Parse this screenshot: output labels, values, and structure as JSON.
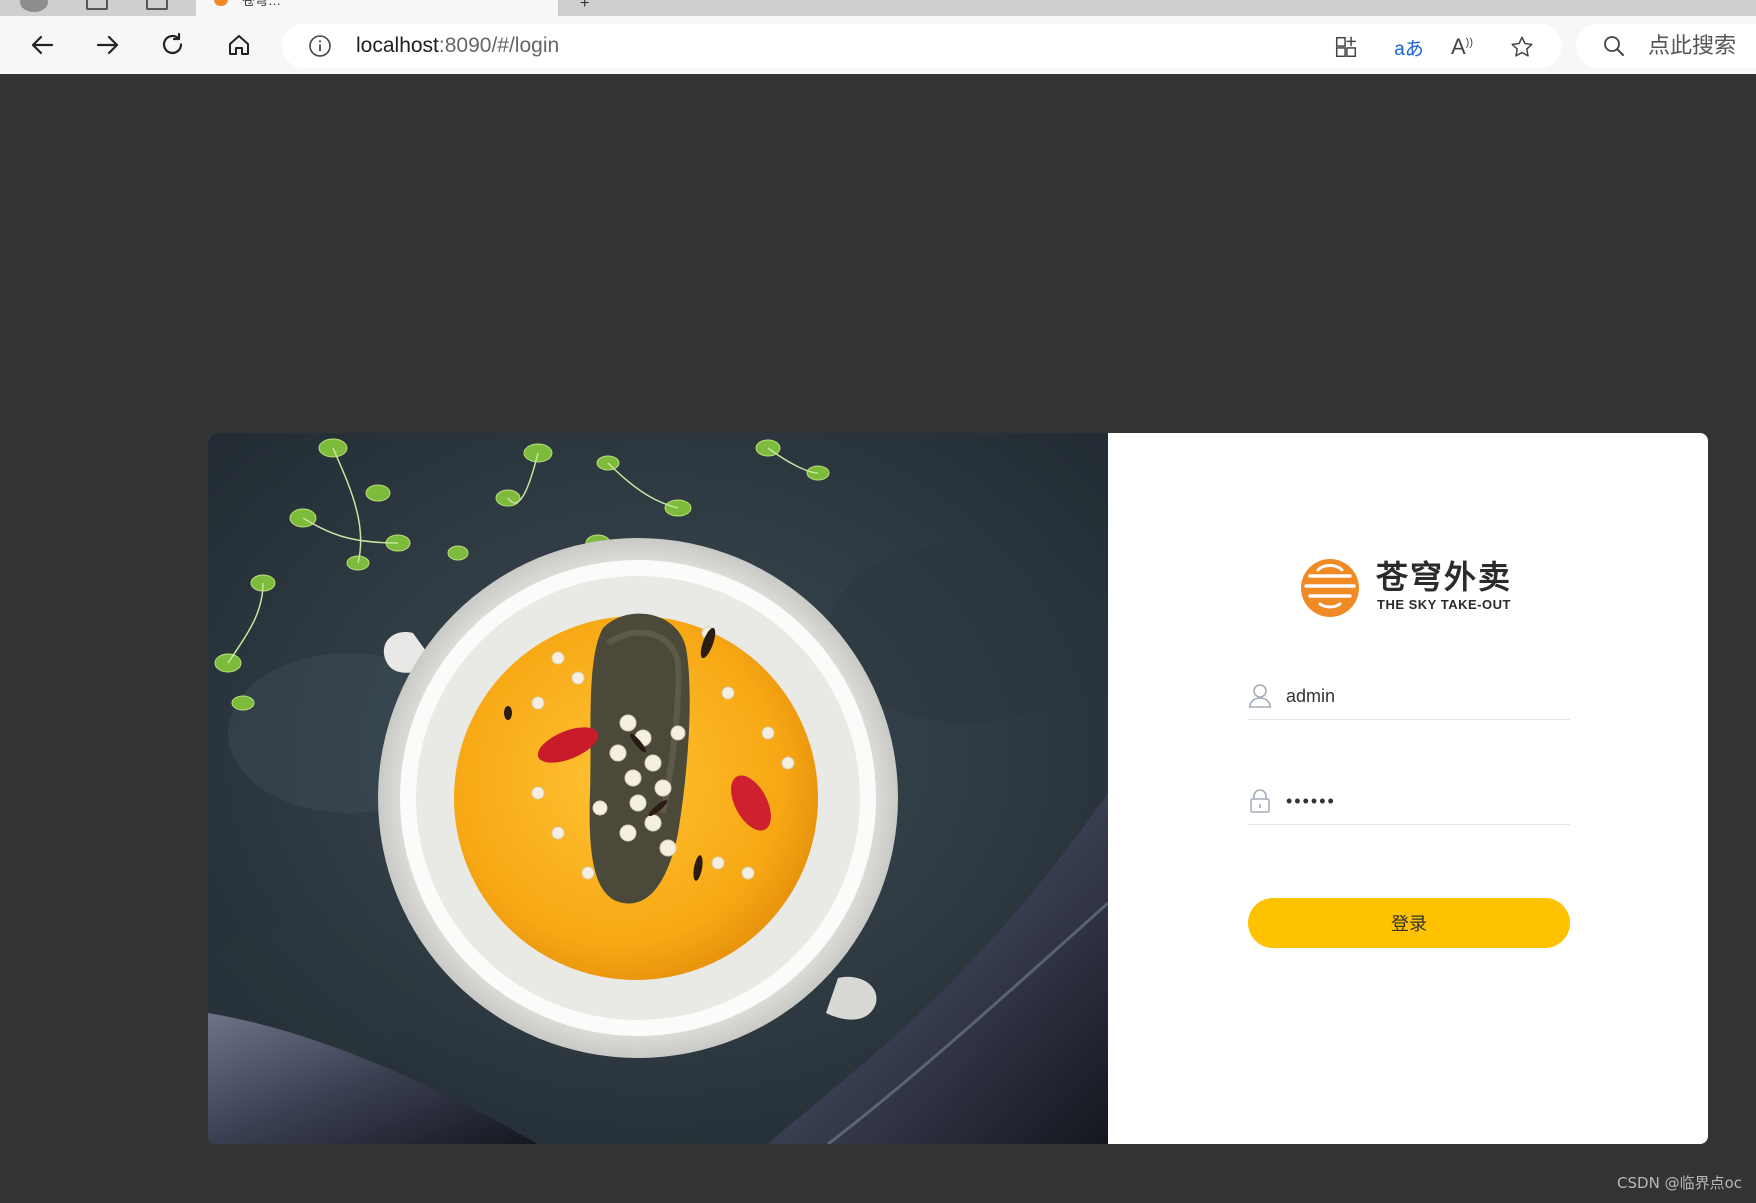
{
  "browser": {
    "active_tab_title": "苍穹…",
    "new_tab_label": "+",
    "url_host": "localhost",
    "url_rest": ":8090/#/login",
    "search_placeholder": "点此搜索",
    "toolbar_icons": [
      "back-arrow-icon",
      "forward-arrow-icon",
      "refresh-icon",
      "home-icon",
      "info-icon",
      "split-screen-icon",
      "translate-icon",
      "read-aloud-icon",
      "favorite-star-icon",
      "search-icon"
    ],
    "translate_glyph": "aあ",
    "read_aloud_glyph": "A"
  },
  "login": {
    "logo_cn": "苍穹外卖",
    "logo_en": "THE SKY TAKE-OUT",
    "username_value": "admin",
    "password_value": "••••••",
    "login_button": "登录"
  },
  "colors": {
    "page_background": "#333333",
    "button": "#ffc200",
    "logo_orange": "#f08a24"
  },
  "watermark": "CSDN @临界点oc"
}
